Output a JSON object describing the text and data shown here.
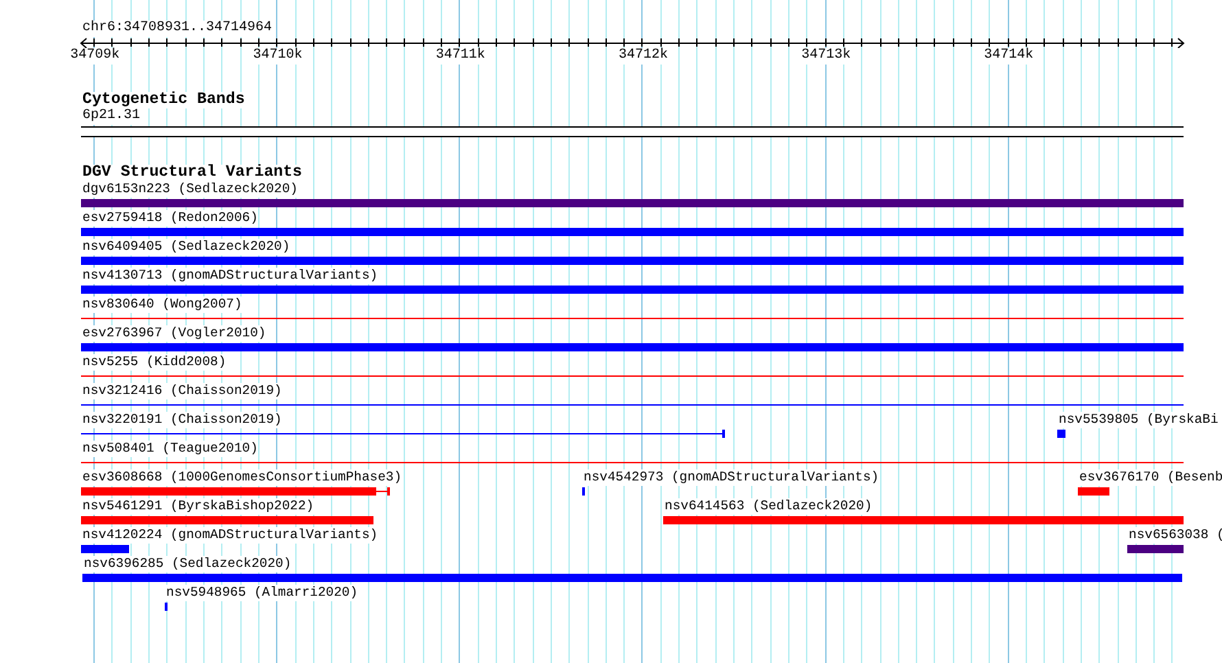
{
  "location": "chr6:34708931..34714964",
  "ruler": {
    "ticks": [
      "34709k",
      "34710k",
      "34711k",
      "34712k",
      "34713k",
      "34714k"
    ]
  },
  "cytoband_track": {
    "title": "Cytogenetic Bands",
    "band": {
      "label": "6p21.31"
    }
  },
  "variant_track": {
    "title": "DGV Structural Variants",
    "rows": [
      {
        "features": [
          {
            "label": "dgv6153n223 (Sedlazeck2020)",
            "color": "#4b0082",
            "kind": "bar"
          }
        ]
      },
      {
        "features": [
          {
            "label": "esv2759418 (Redon2006)",
            "color": "#0000ff",
            "kind": "bar"
          }
        ]
      },
      {
        "features": [
          {
            "label": "nsv6409405 (Sedlazeck2020)",
            "color": "#0000ff",
            "kind": "bar"
          }
        ]
      },
      {
        "features": [
          {
            "label": "nsv4130713 (gnomADStructuralVariants)",
            "color": "#0000ff",
            "kind": "bar"
          }
        ]
      },
      {
        "features": [
          {
            "label": "nsv830640 (Wong2007)",
            "color": "#ff0000",
            "kind": "line"
          }
        ]
      },
      {
        "features": [
          {
            "label": "esv2763967 (Vogler2010)",
            "color": "#0000ff",
            "kind": "bar"
          }
        ]
      },
      {
        "features": [
          {
            "label": "nsv5255 (Kidd2008)",
            "color": "#ff0000",
            "kind": "line"
          }
        ]
      },
      {
        "features": [
          {
            "label": "nsv3212416 (Chaisson2019)",
            "color": "#0000ff",
            "kind": "line"
          }
        ]
      },
      {
        "features": [
          {
            "label": "nsv3220191 (Chaisson2019)",
            "color": "#0000ff",
            "kind": "line_end"
          },
          {
            "label": "nsv5539805 (ByrskaBi",
            "color": "#0000ff",
            "kind": "bar"
          }
        ]
      },
      {
        "features": [
          {
            "label": "nsv508401 (Teague2010)",
            "color": "#ff0000",
            "kind": "line"
          }
        ]
      },
      {
        "features": [
          {
            "label": "esv3608668 (1000GenomesConsortiumPhase3)",
            "color": "#ff0000",
            "kind": "bar_tail"
          },
          {
            "label": "nsv4542973 (gnomADStructuralVariants)",
            "color": "#0000ff",
            "kind": "bar"
          },
          {
            "label": "esv3676170 (Besenb",
            "color": "#ff0000",
            "kind": "bar"
          }
        ]
      },
      {
        "features": [
          {
            "label": "nsv5461291 (ByrskaBishop2022)",
            "color": "#ff0000",
            "kind": "bar"
          },
          {
            "label": "nsv6414563 (Sedlazeck2020)",
            "color": "#ff0000",
            "kind": "bar"
          }
        ]
      },
      {
        "features": [
          {
            "label": "nsv4120224 (gnomADStructuralVariants)",
            "color": "#0000ff",
            "kind": "bar"
          },
          {
            "label": "nsv6563038 (",
            "color": "#4b0082",
            "kind": "bar"
          }
        ]
      },
      {
        "features": [
          {
            "label": "nsv6396285 (Sedlazeck2020)",
            "color": "#0000ff",
            "kind": "bar"
          }
        ]
      },
      {
        "features": [
          {
            "label": "nsv5948965 (Almarri2020)",
            "color": "#0000ff",
            "kind": "bar"
          }
        ]
      }
    ]
  }
}
